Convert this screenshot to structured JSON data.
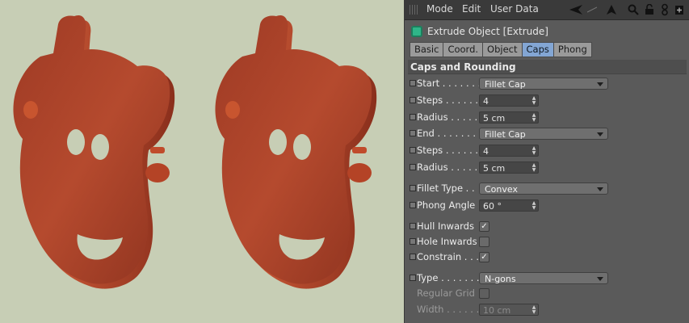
{
  "menubar": {
    "mode": "Mode",
    "edit": "Edit",
    "user_data": "User Data",
    "icons": [
      "back-arrow-icon",
      "up-arrow-icon",
      "search-icon",
      "lock-icon",
      "link-icon",
      "new-panel-icon"
    ]
  },
  "object_title": "Extrude Object [Extrude]",
  "tabs": [
    {
      "label": "Basic",
      "active": false
    },
    {
      "label": "Coord.",
      "active": false
    },
    {
      "label": "Object",
      "active": false
    },
    {
      "label": "Caps",
      "active": true
    },
    {
      "label": "Phong",
      "active": false
    }
  ],
  "section_title": "Caps and Rounding",
  "fields": {
    "start": {
      "label": "Start . . . . . . .",
      "value": "Fillet Cap"
    },
    "steps1": {
      "label": "Steps . . . . . . .",
      "value": "4"
    },
    "radius1": {
      "label": "Radius . . . . . .",
      "value": "5 cm"
    },
    "end": {
      "label": "End . . . . . . . .",
      "value": "Fillet Cap"
    },
    "steps2": {
      "label": "Steps . . . . . . .",
      "value": "4"
    },
    "radius2": {
      "label": "Radius . . . . . .",
      "value": "5 cm"
    },
    "fillet_type": {
      "label": "Fillet Type . .",
      "value": "Convex"
    },
    "phong_angle": {
      "label": "Phong Angle",
      "value": "60 °"
    },
    "hull_inwards": {
      "label": "Hull Inwards",
      "checked": true
    },
    "hole_inwards": {
      "label": "Hole Inwards",
      "checked": false
    },
    "constrain": {
      "label": "Constrain . . .",
      "checked": true
    },
    "type": {
      "label": "Type . . . . . . . .",
      "value": "N-gons"
    },
    "regular_grid": {
      "label": "Regular Grid",
      "checked": false
    },
    "width": {
      "label": "Width . . . . . .",
      "value": "10 cm"
    }
  },
  "colors": {
    "viewport_bg": "#c7ceb5",
    "model": "#b8472c",
    "panel_bg": "#5a5a5a",
    "tab_active": "#83a6d4"
  }
}
